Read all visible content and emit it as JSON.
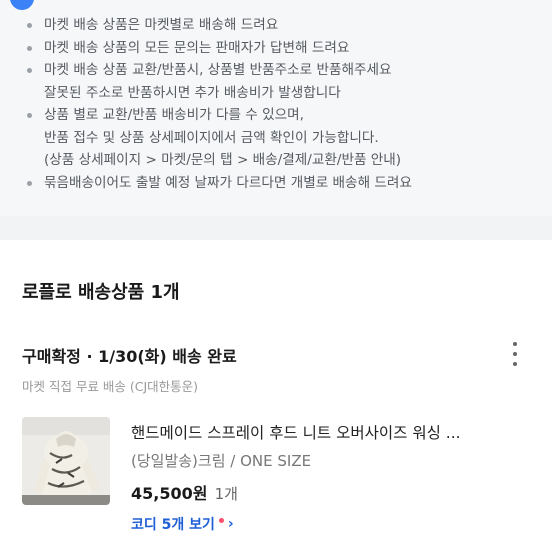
{
  "notice": {
    "items": [
      {
        "lines": [
          "마켓 배송 상품은 마켓별로 배송해 드려요"
        ]
      },
      {
        "lines": [
          "마켓 배송 상품의 모든 문의는 판매자가 답변해 드려요"
        ]
      },
      {
        "lines": [
          "마켓 배송 상품 교환/반품시, 상품별 반품주소로 반품해주세요",
          "잘못된 주소로 반품하시면 추가 배송비가 발생합니다"
        ]
      },
      {
        "lines": [
          "상품 별로 교환/반품 배송비가 다를 수 있으며,",
          "반품 접수 및 상품 상세페이지에서 금액 확인이 가능합니다.",
          "(상품 상세페이지 > 마켓/문의 탭 > 배송/결제/교환/반품 안내)"
        ]
      },
      {
        "lines": [
          "묶음배송이어도 출발 예정 날짜가 다르다면 개별로 배송해 드려요"
        ]
      }
    ]
  },
  "section": {
    "title": "로플로 배송상품 1개"
  },
  "order": {
    "status": "구매확정 · 1/30(화) 배송 완료",
    "shipping_info": "마켓 직접 무료 배송 (CJ대한통운)",
    "more_icon": "more-vertical-icon",
    "product": {
      "name": "핸드메이드 스프레이 후드 니트 오버사이즈 워싱 ...",
      "option": "(당일발송)크림 / ONE SIZE",
      "price": "45,500원",
      "quantity": "1개"
    },
    "codi_link": {
      "label": "코디 5개 보기",
      "chevron": "›"
    }
  },
  "colors": {
    "accent": "#1f5fd6",
    "new_dot": "#ff4d6d",
    "notice_bg": "#f6f7f9"
  }
}
